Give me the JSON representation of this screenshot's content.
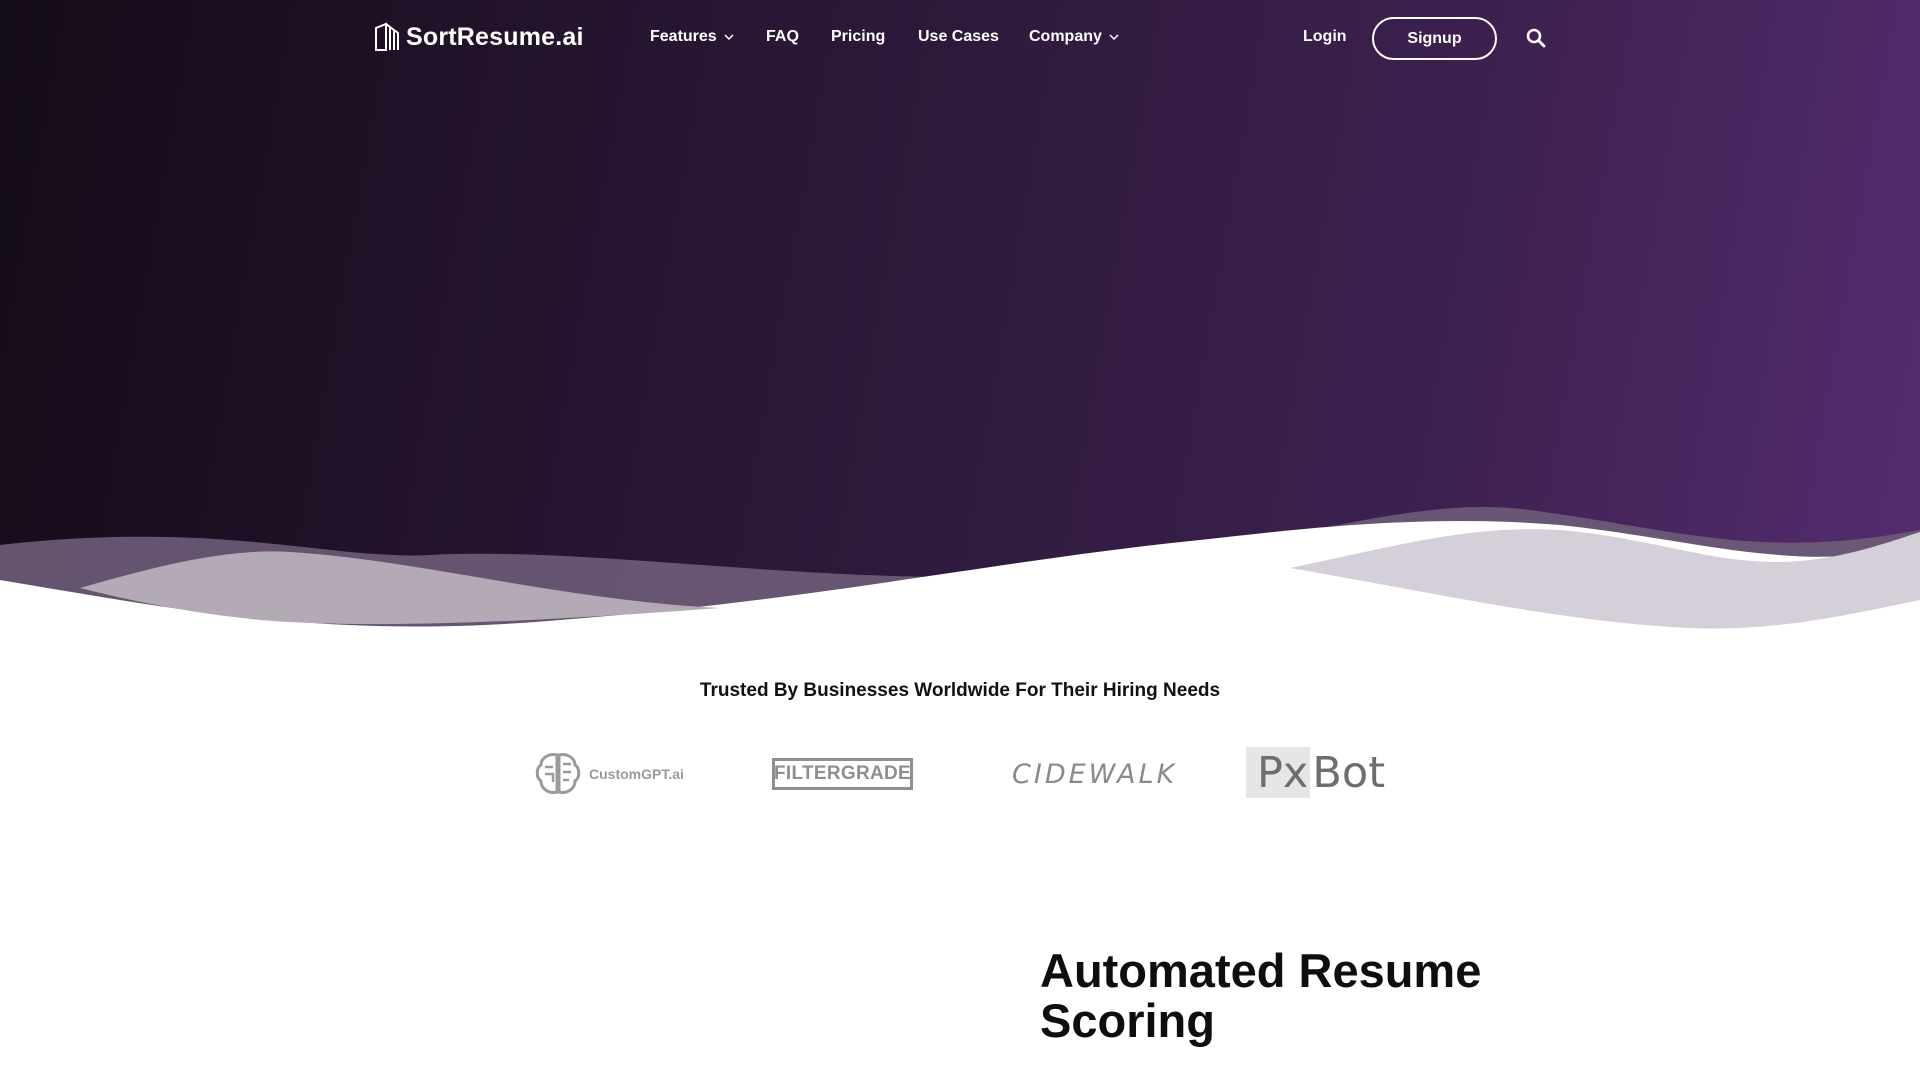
{
  "brand": {
    "name": "SortResume.ai",
    "icon": "book-stack-icon"
  },
  "nav": {
    "items": [
      {
        "label": "Features",
        "has_dropdown": true
      },
      {
        "label": "FAQ",
        "has_dropdown": false
      },
      {
        "label": "Pricing",
        "has_dropdown": false
      },
      {
        "label": "Use Cases",
        "has_dropdown": false
      },
      {
        "label": "Company",
        "has_dropdown": true
      }
    ],
    "login_label": "Login",
    "signup_label": "Signup",
    "search_icon": "search-icon"
  },
  "trusted": {
    "heading": "Trusted By Businesses Worldwide For Their Hiring Needs",
    "logos": [
      "CustomGPT.ai",
      "FILTERGRADE",
      "CIDEWALK",
      "PxBot"
    ]
  },
  "logo_parts": {
    "pxbot_px": "Px",
    "pxbot_bot": "Bot"
  },
  "section": {
    "heading": "Automated Resume Scoring"
  },
  "colors": {
    "hero_start": "#140b17",
    "hero_end": "#552c70",
    "text": "#111111"
  }
}
